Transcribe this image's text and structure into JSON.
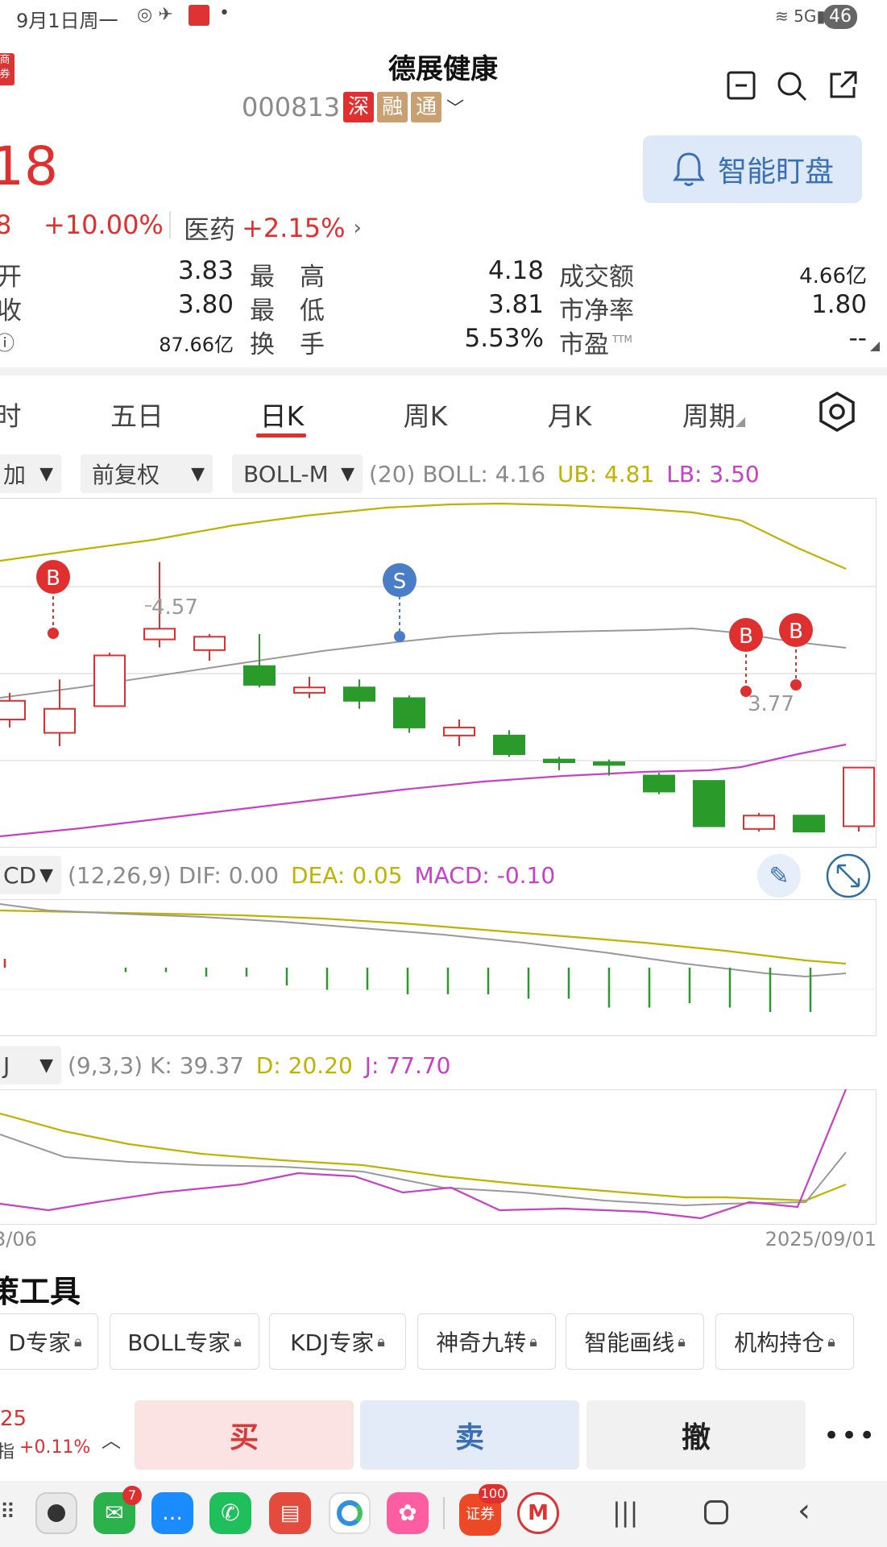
{
  "status_bar": {
    "time": "9月1日周一",
    "battery": "46",
    "network": "5G"
  },
  "header": {
    "title": "德展健康",
    "code": "000813",
    "tags": [
      "深",
      "融",
      "通"
    ],
    "logo_text": "商券",
    "smart_button": "智能盯盘"
  },
  "quote": {
    "price_partial": "18",
    "change_partial": "8",
    "change_pct": "+10.00%",
    "sector_name": "医药",
    "sector_pct": "+2.15%",
    "rows": [
      {
        "l1": "开",
        "v1": "3.83",
        "l2": "最　高",
        "v2": "4.18",
        "l3": "成交额",
        "v3": "4.66亿"
      },
      {
        "l1": "收",
        "v1": "3.80",
        "l2": "最　低",
        "v2": "3.81",
        "l3": "市净率",
        "v3": "1.80"
      },
      {
        "l1": "ⓘ",
        "v1": "87.66亿",
        "l2": "换　手",
        "v2": "5.53%",
        "l3": "市盈",
        "v3": "--"
      }
    ],
    "ttm": "TTM"
  },
  "tabs": [
    "时",
    "五日",
    "日K",
    "周K",
    "月K",
    "周期"
  ],
  "boll_toolbar": {
    "drop1": "加",
    "drop2": "前复权",
    "drop3": "BOLL-M",
    "params": "(20) BOLL: 4.16",
    "ub": "UB: 4.81",
    "lb": "LB: 3.50"
  },
  "kline_labels": {
    "high": "4.57",
    "low": "3.77",
    "buy": "B",
    "sell": "S"
  },
  "macd": {
    "drop": "CD",
    "params": "(12,26,9) DIF: 0.00",
    "dea": "DEA: 0.05",
    "macd": "MACD: -0.10"
  },
  "kdj": {
    "drop": "J",
    "params": "(9,3,3) K: 39.37",
    "d": "D: 20.20",
    "j": "J: 77.70"
  },
  "dates": {
    "start": "3/06",
    "end": "2025/09/01"
  },
  "tools": {
    "title": "策工具",
    "items": [
      "D专家",
      "BOLL专家",
      "KDJ专家",
      "神奇九转",
      "智能画线",
      "机构持仓"
    ]
  },
  "bottom": {
    "index_val": "25",
    "index_label": "指",
    "index_pct": "+0.11%",
    "buy": "买",
    "sell": "卖",
    "cancel": "撤"
  },
  "nav": {
    "wechat_badge": "7",
    "broker_badge": "100",
    "broker_text": "证券"
  },
  "colors": {
    "up": "#e02f2f",
    "down": "#2a9a2a",
    "boll_ub": "#bfb200",
    "boll_lb": "#c640c8",
    "buy_bg": "#fbe3e3",
    "sell_bg": "#e3ebf8",
    "cancel_bg": "#f1f1f1",
    "accent": "#3a6fb3"
  },
  "candles": [
    {
      "o": 3.98,
      "c": 4.05,
      "h": 4.08,
      "l": 3.95
    },
    {
      "o": 3.93,
      "c": 4.02,
      "h": 4.13,
      "l": 3.88
    },
    {
      "o": 4.03,
      "c": 4.22,
      "h": 4.23,
      "l": 4.03
    },
    {
      "o": 4.28,
      "c": 4.32,
      "h": 4.57,
      "l": 4.25
    },
    {
      "o": 4.24,
      "c": 4.29,
      "h": 4.3,
      "l": 4.2
    },
    {
      "o": 4.18,
      "c": 4.11,
      "h": 4.3,
      "l": 4.1
    },
    {
      "o": 4.08,
      "c": 4.1,
      "h": 4.14,
      "l": 4.06
    },
    {
      "o": 4.1,
      "c": 4.05,
      "h": 4.13,
      "l": 4.02
    },
    {
      "o": 4.06,
      "c": 3.95,
      "h": 4.07,
      "l": 3.93
    },
    {
      "o": 3.92,
      "c": 3.95,
      "h": 3.98,
      "l": 3.88
    },
    {
      "o": 3.92,
      "c": 3.85,
      "h": 3.94,
      "l": 3.84
    },
    {
      "o": 3.83,
      "c": 3.82,
      "h": 3.84,
      "l": 3.79
    },
    {
      "o": 3.82,
      "c": 3.81,
      "h": 3.83,
      "l": 3.77
    },
    {
      "o": 3.77,
      "c": 3.71,
      "h": 3.78,
      "l": 3.7
    },
    {
      "o": 3.75,
      "c": 3.58,
      "h": 3.75,
      "l": 3.58
    },
    {
      "o": 3.57,
      "c": 3.62,
      "h": 3.63,
      "l": 3.56
    },
    {
      "o": 3.62,
      "c": 3.56,
      "h": 3.62,
      "l": 3.56
    },
    {
      "o": 3.58,
      "c": 3.8,
      "h": 3.8,
      "l": 3.56
    }
  ],
  "macd_bars": [
    0.02,
    0.0,
    0.0,
    -0.01,
    -0.01,
    -0.02,
    -0.02,
    -0.04,
    -0.05,
    -0.05,
    -0.06,
    -0.06,
    -0.06,
    -0.07,
    -0.07,
    -0.09,
    -0.09,
    -0.08,
    -0.09,
    -0.1,
    -0.1
  ]
}
